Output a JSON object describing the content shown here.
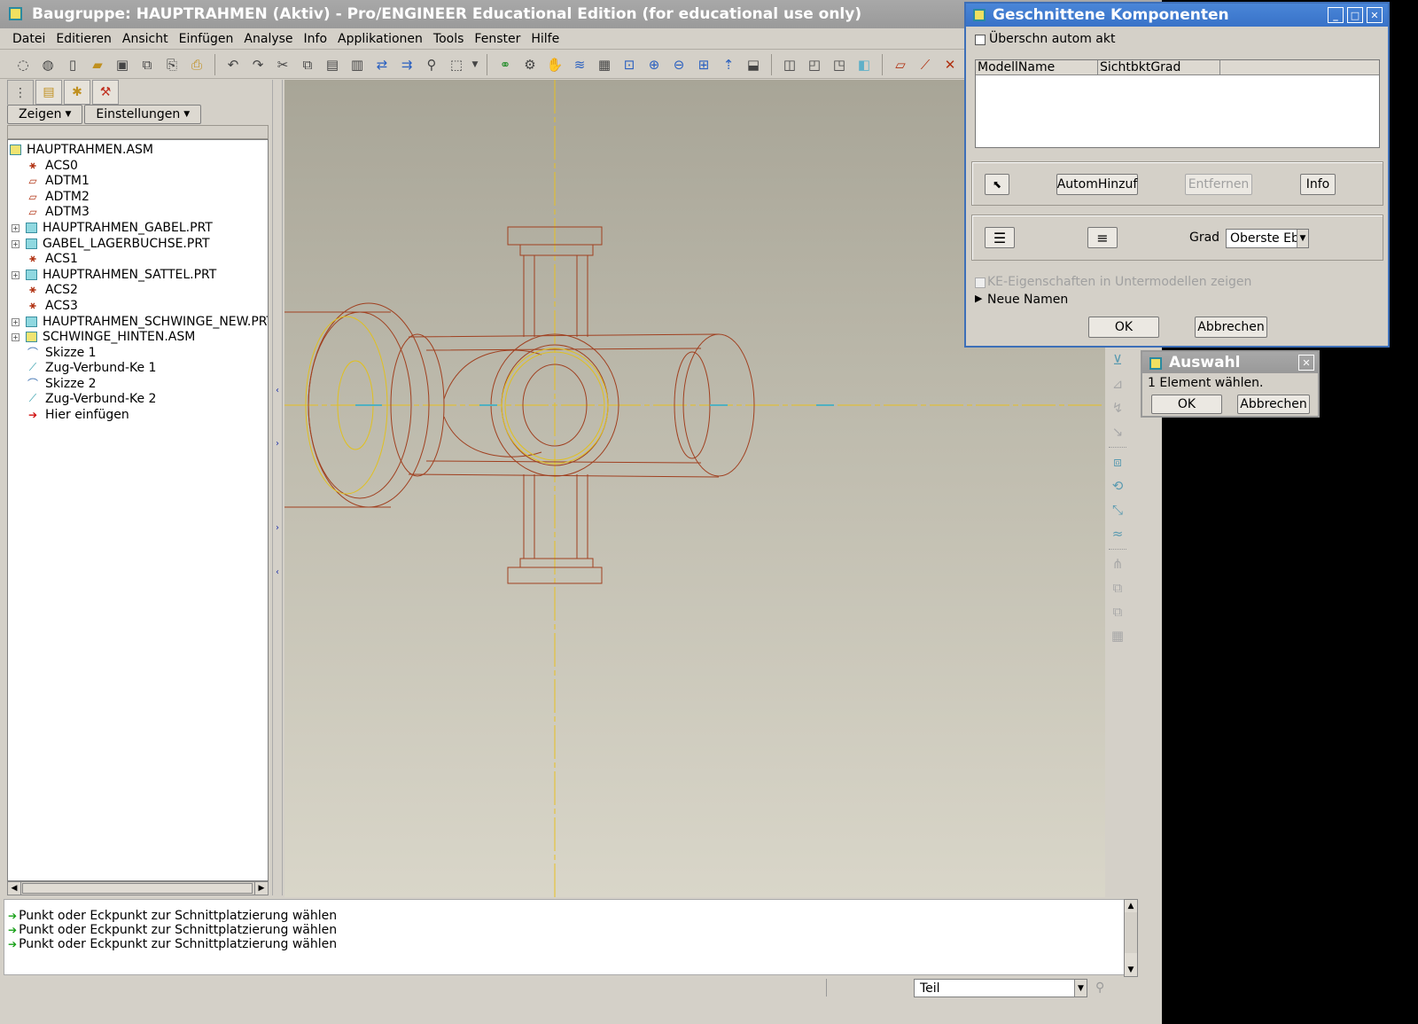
{
  "window": {
    "title": "Baugruppe: HAUPTRAHMEN (Aktiv) - Pro/ENGINEER Educational Edition (for educational use only)"
  },
  "menu": [
    {
      "label": "Datei"
    },
    {
      "label": "Editieren"
    },
    {
      "label": "Ansicht"
    },
    {
      "label": "Einfügen"
    },
    {
      "label": "Analyse"
    },
    {
      "label": "Info"
    },
    {
      "label": "Applikationen"
    },
    {
      "label": "Tools"
    },
    {
      "label": "Fenster"
    },
    {
      "label": "Hilfe"
    }
  ],
  "panel": {
    "show_label": "Zeigen",
    "settings_label": "Einstellungen"
  },
  "tree": [
    {
      "label": "HAUPTRAHMEN.ASM",
      "icon": "assembly-icon"
    },
    {
      "label": "ACS0",
      "icon": "csys-icon"
    },
    {
      "label": "ADTM1",
      "icon": "datum-plane-icon"
    },
    {
      "label": "ADTM2",
      "icon": "datum-plane-icon"
    },
    {
      "label": "ADTM3",
      "icon": "datum-plane-icon"
    },
    {
      "label": "HAUPTRAHMEN_GABEL.PRT",
      "icon": "part-icon",
      "expandable": true
    },
    {
      "label": "GABEL_LAGERBUCHSE.PRT",
      "icon": "part-icon",
      "expandable": true
    },
    {
      "label": "ACS1",
      "icon": "csys-icon"
    },
    {
      "label": "HAUPTRAHMEN_SATTEL.PRT",
      "icon": "part-icon",
      "expandable": true
    },
    {
      "label": "ACS2",
      "icon": "csys-icon"
    },
    {
      "label": "ACS3",
      "icon": "csys-icon"
    },
    {
      "label": "HAUPTRAHMEN_SCHWINGE_NEW.PRT",
      "icon": "part-icon",
      "expandable": true
    },
    {
      "label": "SCHWINGE_HINTEN.ASM",
      "icon": "assembly-icon",
      "expandable": true
    },
    {
      "label": "Skizze 1",
      "icon": "sketch-icon"
    },
    {
      "label": "Zug-Verbund-Ke 1",
      "icon": "blend-icon"
    },
    {
      "label": "Skizze 2",
      "icon": "sketch-icon"
    },
    {
      "label": "Zug-Verbund-Ke 2",
      "icon": "blend-icon"
    },
    {
      "label": "Hier einfügen",
      "icon": "insert-here-icon"
    }
  ],
  "messages": [
    "Punkt oder Eckpunkt zur Schnittplatzierung wählen",
    "Punkt oder Eckpunkt zur Schnittplatzierung wählen",
    "Punkt oder Eckpunkt zur Schnittplatzierung wählen"
  ],
  "status": {
    "filter_value": "Teil"
  },
  "cut_dialog": {
    "title": "Geschnittene Komponenten",
    "auto_update_label": "Überschn autom akt",
    "columns": [
      "ModellName",
      "SichtbktGrad"
    ],
    "auto_add_label": "AutomHinzuf",
    "remove_label": "Entfernen",
    "info_label": "Info",
    "level_label": "Grad",
    "level_value": "Oberste Ebe",
    "show_features_label": "KE-Eigenschaften in Untermodellen zeigen",
    "new_names_label": "Neue Namen",
    "ok_label": "OK",
    "cancel_label": "Abbrechen"
  },
  "select_dialog": {
    "title": "Auswahl",
    "prompt": "1 Element wählen.",
    "ok_label": "OK",
    "cancel_label": "Abbrechen"
  }
}
